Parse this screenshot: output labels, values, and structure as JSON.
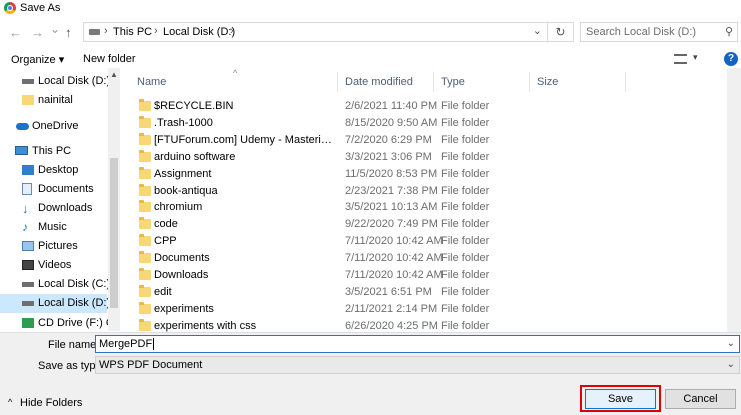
{
  "window": {
    "title": "Save As",
    "app_icon": "chrome-icon"
  },
  "nav": {
    "back": "←",
    "forward": "→",
    "dropdown": "⌄",
    "up": "↑",
    "breadcrumb": [
      "This PC",
      "Local Disk (D:)"
    ],
    "refresh": "↻",
    "search_placeholder": "Search Local Disk (D:)"
  },
  "toolbar": {
    "organize": "Organize ▾",
    "new_folder": "New folder",
    "help": "?"
  },
  "tree": [
    {
      "label": "Local Disk (D:)",
      "icon": "drive-icon"
    },
    {
      "label": "nainital",
      "icon": "folder-icon"
    },
    {
      "label": "OneDrive",
      "icon": "cloud-icon"
    },
    {
      "label": "This PC",
      "icon": "computer-icon"
    },
    {
      "label": "Desktop",
      "icon": "desktop-icon"
    },
    {
      "label": "Documents",
      "icon": "documents-icon"
    },
    {
      "label": "Downloads",
      "icon": "downloads-icon"
    },
    {
      "label": "Music",
      "icon": "music-icon"
    },
    {
      "label": "Pictures",
      "icon": "pictures-icon"
    },
    {
      "label": "Videos",
      "icon": "videos-icon"
    },
    {
      "label": "Local Disk (C:)",
      "icon": "drive-icon"
    },
    {
      "label": "Local Disk (D:)",
      "icon": "drive-icon"
    },
    {
      "label": "CD Drive (F:) OP",
      "icon": "cd-drive-icon"
    }
  ],
  "columns": {
    "name": "Name",
    "date": "Date modified",
    "type": "Type",
    "size": "Size"
  },
  "files": [
    {
      "name": "$RECYCLE.BIN",
      "date": "2/6/2021 11:40 PM",
      "type": "File folder"
    },
    {
      "name": ".Trash-1000",
      "date": "8/15/2020 9:50 AM",
      "type": "File folder"
    },
    {
      "name": "[FTUForum.com] Udemy - Mastering Dat...",
      "date": "7/2/2020 6:29 PM",
      "type": "File folder"
    },
    {
      "name": "arduino software",
      "date": "3/3/2021 3:06 PM",
      "type": "File folder"
    },
    {
      "name": "Assignment",
      "date": "11/5/2020 8:53 PM",
      "type": "File folder"
    },
    {
      "name": "book-antiqua",
      "date": "2/23/2021 7:38 PM",
      "type": "File folder"
    },
    {
      "name": "chromium",
      "date": "3/5/2021 10:13 AM",
      "type": "File folder"
    },
    {
      "name": "code",
      "date": "9/22/2020 7:49 PM",
      "type": "File folder"
    },
    {
      "name": "CPP",
      "date": "7/11/2020 10:42 AM",
      "type": "File folder"
    },
    {
      "name": "Documents",
      "date": "7/11/2020 10:42 AM",
      "type": "File folder"
    },
    {
      "name": "Downloads",
      "date": "7/11/2020 10:42 AM",
      "type": "File folder"
    },
    {
      "name": "edit",
      "date": "3/5/2021 6:51 PM",
      "type": "File folder"
    },
    {
      "name": "experiments",
      "date": "2/11/2021 2:14 PM",
      "type": "File folder"
    },
    {
      "name": "experiments with css",
      "date": "6/26/2020 4:25 PM",
      "type": "File folder"
    }
  ],
  "form": {
    "file_name_label": "File name:",
    "file_name_value": "MergePDF",
    "save_type_label": "Save as type:",
    "save_type_value": "WPS PDF Document"
  },
  "footer": {
    "hide_folders": "Hide Folders",
    "save": "Save",
    "cancel": "Cancel"
  }
}
